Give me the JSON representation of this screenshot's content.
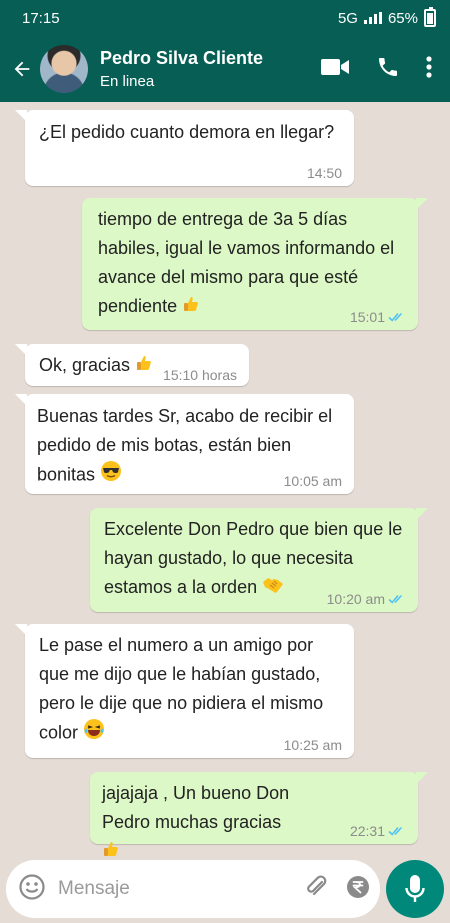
{
  "status_bar": {
    "time": "17:15",
    "network": "5G",
    "battery": "65%"
  },
  "header": {
    "name": "Pedro Silva Cliente",
    "status": "En linea"
  },
  "messages": [
    {
      "dir": "in",
      "text": "¿El pedido cuanto demora en llegar?",
      "time": "14:50",
      "emoji": ""
    },
    {
      "dir": "out",
      "text": "tiempo de entrega de 3a 5 días habiles, igual le vamos informando el avance del mismo para que esté pendiente",
      "time": "15:01",
      "emoji": "thumbs-up"
    },
    {
      "dir": "in",
      "text": "Ok, gracias",
      "time": "15:10 horas",
      "emoji": "thumbs-up"
    },
    {
      "dir": "in",
      "text": "Buenas tardes Sr, acabo de recibir el pedido de mis botas, están bien bonitas",
      "time": "10:05 am",
      "emoji": "sunglasses"
    },
    {
      "dir": "out",
      "text": "Excelente Don Pedro que bien que le hayan gustado, lo que necesita estamos a la orden",
      "time": "10:20 am",
      "emoji": "handshake"
    },
    {
      "dir": "in",
      "text": "Le pase el numero a un amigo por que me dijo que le habían gustado, pero le dije que no pidiera el mismo color",
      "time": "10:25 am",
      "emoji": "laughing"
    },
    {
      "dir": "out",
      "text": "jajajaja , Un bueno Don Pedro muchas gracias",
      "time": "22:31",
      "emoji": "thumbs-up"
    }
  ],
  "composer": {
    "placeholder": "Mensaje"
  },
  "colors": {
    "header": "#075e54",
    "outgoing": "#dcf8c6",
    "incoming": "#ffffff",
    "background": "#e5ddd5",
    "read_ticks": "#4fc3f7",
    "mic": "#00897b"
  }
}
